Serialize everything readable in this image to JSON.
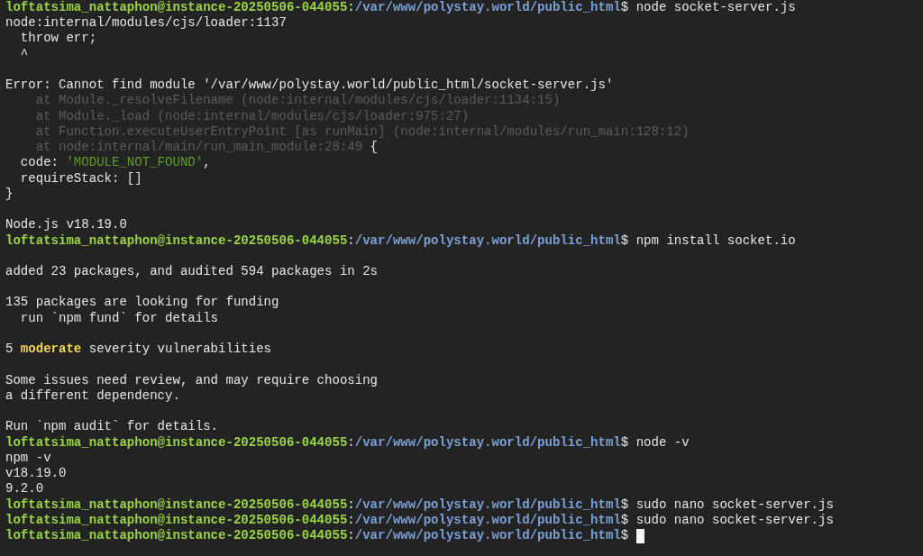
{
  "terminal": {
    "lines": [
      {
        "kind": "prompt",
        "user": "loftatsima_nattaphon@instance-20250506-044055",
        "sep": ":",
        "path": "/var/www/polystay.world/public_html",
        "symbol": "$",
        "command": "node socket-server.js",
        "cursor": false
      },
      {
        "kind": "text",
        "segments": [
          {
            "text": "node:internal/modules/cjs/loader:1137",
            "kind": "plain"
          }
        ]
      },
      {
        "kind": "text",
        "segments": [
          {
            "text": "  throw err;",
            "kind": "plain"
          }
        ]
      },
      {
        "kind": "text",
        "segments": [
          {
            "text": "  ^",
            "kind": "plain"
          }
        ]
      },
      {
        "kind": "blank"
      },
      {
        "kind": "text",
        "segments": [
          {
            "text": "Error: Cannot find module '/var/www/polystay.world/public_html/socket-server.js'",
            "kind": "plain"
          }
        ]
      },
      {
        "kind": "text",
        "segments": [
          {
            "text": "    at Module._resolveFilename (node:internal/modules/cjs/loader:1134:15)",
            "kind": "dim"
          }
        ]
      },
      {
        "kind": "text",
        "segments": [
          {
            "text": "    at Module._load (node:internal/modules/cjs/loader:975:27)",
            "kind": "dim"
          }
        ]
      },
      {
        "kind": "text",
        "segments": [
          {
            "text": "    at Function.executeUserEntryPoint [as runMain] (node:internal/modules/run_main:128:12)",
            "kind": "dim"
          }
        ]
      },
      {
        "kind": "text",
        "segments": [
          {
            "text": "    at node:internal/main/run_main_module:28:49",
            "kind": "dim"
          },
          {
            "text": " {",
            "kind": "plain"
          }
        ]
      },
      {
        "kind": "text",
        "segments": [
          {
            "text": "  code: ",
            "kind": "plain"
          },
          {
            "text": "'MODULE_NOT_FOUND'",
            "kind": "string"
          },
          {
            "text": ",",
            "kind": "plain"
          }
        ]
      },
      {
        "kind": "text",
        "segments": [
          {
            "text": "  requireStack: []",
            "kind": "plain"
          }
        ]
      },
      {
        "kind": "text",
        "segments": [
          {
            "text": "}",
            "kind": "plain"
          }
        ]
      },
      {
        "kind": "blank"
      },
      {
        "kind": "text",
        "segments": [
          {
            "text": "Node.js v18.19.0",
            "kind": "plain"
          }
        ]
      },
      {
        "kind": "prompt",
        "user": "loftatsima_nattaphon@instance-20250506-044055",
        "sep": ":",
        "path": "/var/www/polystay.world/public_html",
        "symbol": "$",
        "command": "npm install socket.io",
        "cursor": false
      },
      {
        "kind": "blank"
      },
      {
        "kind": "text",
        "segments": [
          {
            "text": "added 23 packages, and audited 594 packages in 2s",
            "kind": "plain"
          }
        ]
      },
      {
        "kind": "blank"
      },
      {
        "kind": "text",
        "segments": [
          {
            "text": "135 packages are looking for funding",
            "kind": "plain"
          }
        ]
      },
      {
        "kind": "text",
        "segments": [
          {
            "text": "  run `npm fund` for details",
            "kind": "plain"
          }
        ]
      },
      {
        "kind": "blank"
      },
      {
        "kind": "text",
        "segments": [
          {
            "text": "5 ",
            "kind": "plain"
          },
          {
            "text": "moderate",
            "kind": "warn"
          },
          {
            "text": " severity vulnerabilities",
            "kind": "plain"
          }
        ]
      },
      {
        "kind": "blank"
      },
      {
        "kind": "text",
        "segments": [
          {
            "text": "Some issues need review, and may require choosing",
            "kind": "plain"
          }
        ]
      },
      {
        "kind": "text",
        "segments": [
          {
            "text": "a different dependency.",
            "kind": "plain"
          }
        ]
      },
      {
        "kind": "blank"
      },
      {
        "kind": "text",
        "segments": [
          {
            "text": "Run `npm audit` for details.",
            "kind": "plain"
          }
        ]
      },
      {
        "kind": "prompt",
        "user": "loftatsima_nattaphon@instance-20250506-044055",
        "sep": ":",
        "path": "/var/www/polystay.world/public_html",
        "symbol": "$",
        "command": "node -v",
        "cursor": false
      },
      {
        "kind": "text",
        "segments": [
          {
            "text": "npm -v",
            "kind": "plain"
          }
        ]
      },
      {
        "kind": "text",
        "segments": [
          {
            "text": "v18.19.0",
            "kind": "plain"
          }
        ]
      },
      {
        "kind": "text",
        "segments": [
          {
            "text": "9.2.0",
            "kind": "plain"
          }
        ]
      },
      {
        "kind": "prompt",
        "user": "loftatsima_nattaphon@instance-20250506-044055",
        "sep": ":",
        "path": "/var/www/polystay.world/public_html",
        "symbol": "$",
        "command": "sudo nano socket-server.js",
        "cursor": false
      },
      {
        "kind": "prompt",
        "user": "loftatsima_nattaphon@instance-20250506-044055",
        "sep": ":",
        "path": "/var/www/polystay.world/public_html",
        "symbol": "$",
        "command": "sudo nano socket-server.js",
        "cursor": false
      },
      {
        "kind": "prompt",
        "user": "loftatsima_nattaphon@instance-20250506-044055",
        "sep": ":",
        "path": "/var/www/polystay.world/public_html",
        "symbol": "$",
        "cursor": true
      }
    ]
  }
}
